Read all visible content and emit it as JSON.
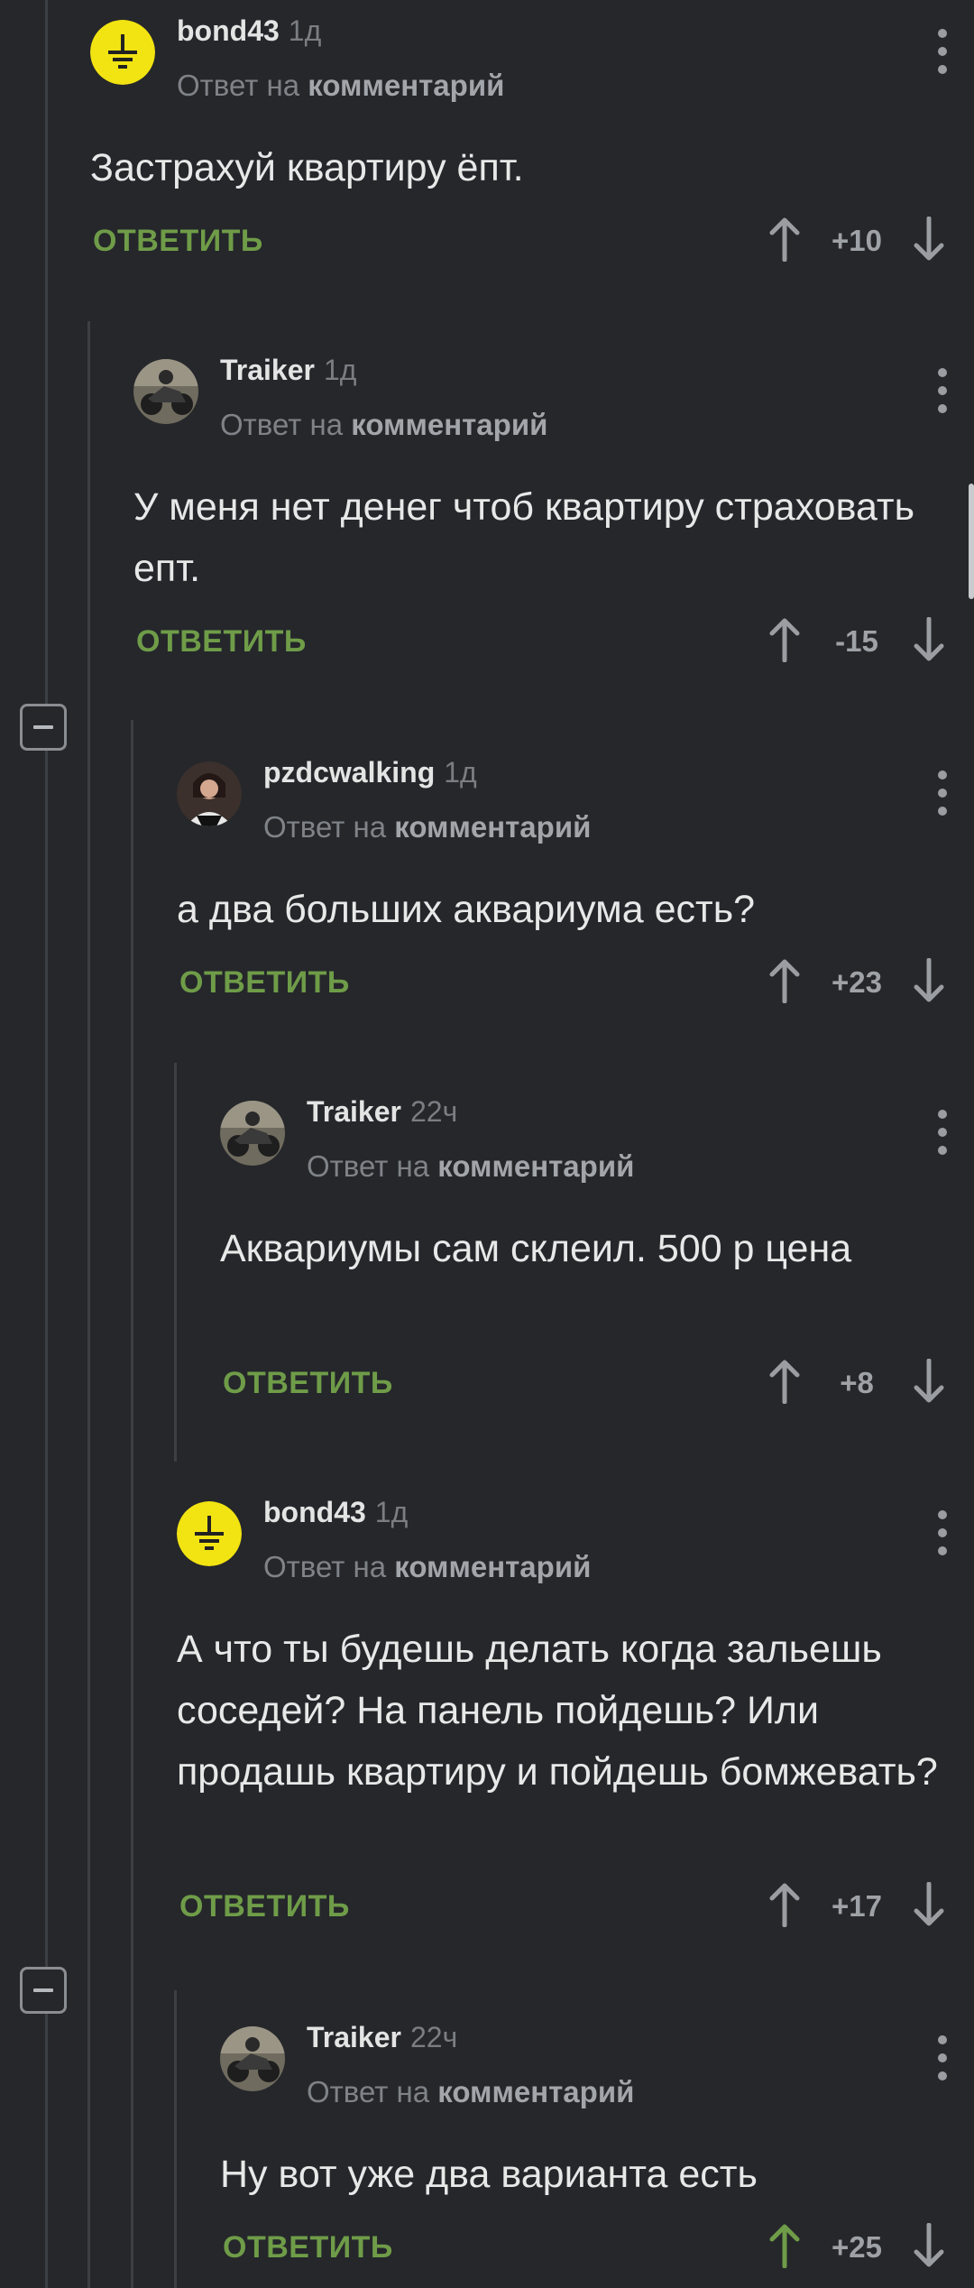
{
  "reply_label": "ОТВЕТИТЬ",
  "reply_prefix": "Ответ на",
  "reply_target": "комментарий",
  "colors": {
    "background": "#25272b",
    "reply": "#6f9c48",
    "upvoted": "#6f9c48",
    "text": "#e8e8e8"
  },
  "comments": [
    {
      "author": "bond43",
      "time": "1д",
      "text": "Застрахуй квартиру ёпт.",
      "score": "+10",
      "avatar_icon": "ground-symbol-icon"
    },
    {
      "author": "Traiker",
      "time": "1д",
      "text": "У меня нет денег чтоб квартиру страховать епт.",
      "score": "-15",
      "avatar_icon": "motorcycle-photo"
    },
    {
      "author": "pzdcwalking",
      "time": "1д",
      "text": "а два больших аквариума есть?",
      "score": "+23",
      "avatar_icon": "person-photo"
    },
    {
      "author": "Traiker",
      "time": "22ч",
      "text": "Аквариумы сам склеил. 500 р цена",
      "score": "+8",
      "avatar_icon": "motorcycle-photo"
    },
    {
      "author": "bond43",
      "time": "1д",
      "text": "А что ты будешь делать когда зальешь соседей? На панель пойдешь? Или продашь квартиру и пойдешь бомжевать?",
      "score": "+17",
      "avatar_icon": "ground-symbol-icon"
    },
    {
      "author": "Traiker",
      "time": "22ч",
      "text": "Ну вот уже два варианта есть",
      "score": "+25",
      "avatar_icon": "motorcycle-photo",
      "upvoted": true
    }
  ]
}
